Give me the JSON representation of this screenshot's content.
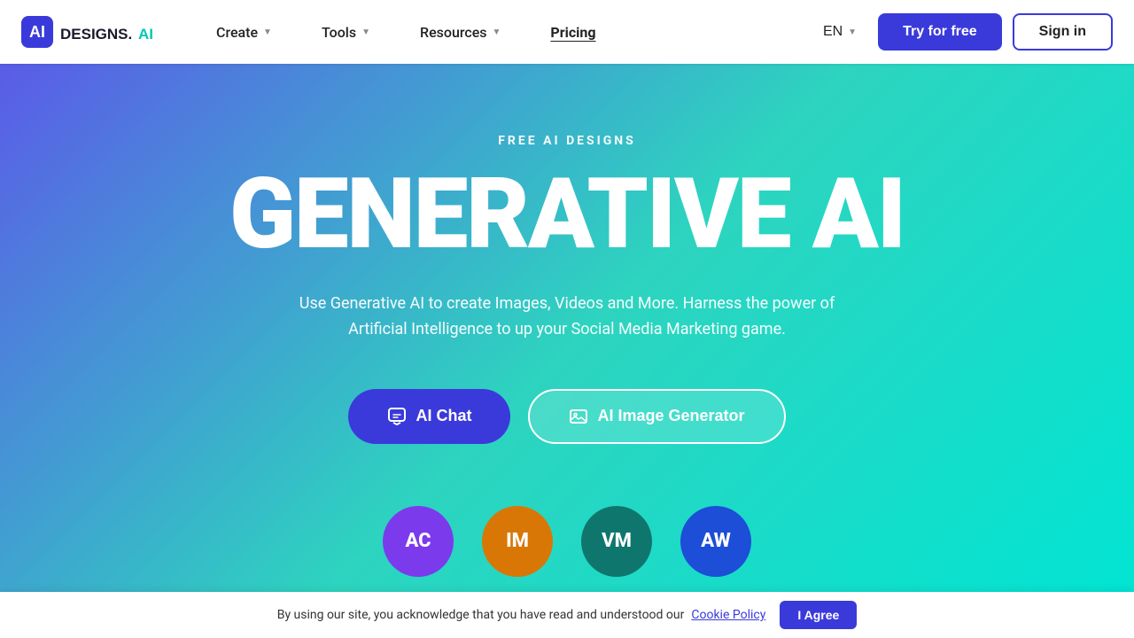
{
  "brand": {
    "name": "DESIGNS.AI",
    "logo_text": "DESIGNS.AI"
  },
  "navbar": {
    "items": [
      {
        "id": "create",
        "label": "Create",
        "has_dropdown": true
      },
      {
        "id": "tools",
        "label": "Tools",
        "has_dropdown": true
      },
      {
        "id": "resources",
        "label": "Resources",
        "has_dropdown": true
      },
      {
        "id": "pricing",
        "label": "Pricing",
        "has_dropdown": false
      }
    ],
    "lang": "EN",
    "try_free_label": "Try for free",
    "sign_in_label": "Sign in"
  },
  "hero": {
    "eyebrow": "FREE AI DESIGNS",
    "title": "GENERATIVE AI",
    "subtitle": "Use Generative AI to create Images, Videos and More. Harness the power of Artificial Intelligence to up your Social Media Marketing game.",
    "btn_chat": "AI Chat",
    "btn_image": "AI Image Generator"
  },
  "avatars": [
    {
      "initials": "AC",
      "color_class": "avatar-ac"
    },
    {
      "initials": "IM",
      "color_class": "avatar-im"
    },
    {
      "initials": "VM",
      "color_class": "avatar-vm"
    },
    {
      "initials": "AW",
      "color_class": "avatar-aw"
    }
  ],
  "cookie": {
    "message": "By using our site, you acknowledge that you have read and understood our",
    "link_text": "Cookie Policy",
    "btn_label": "I Agree"
  }
}
